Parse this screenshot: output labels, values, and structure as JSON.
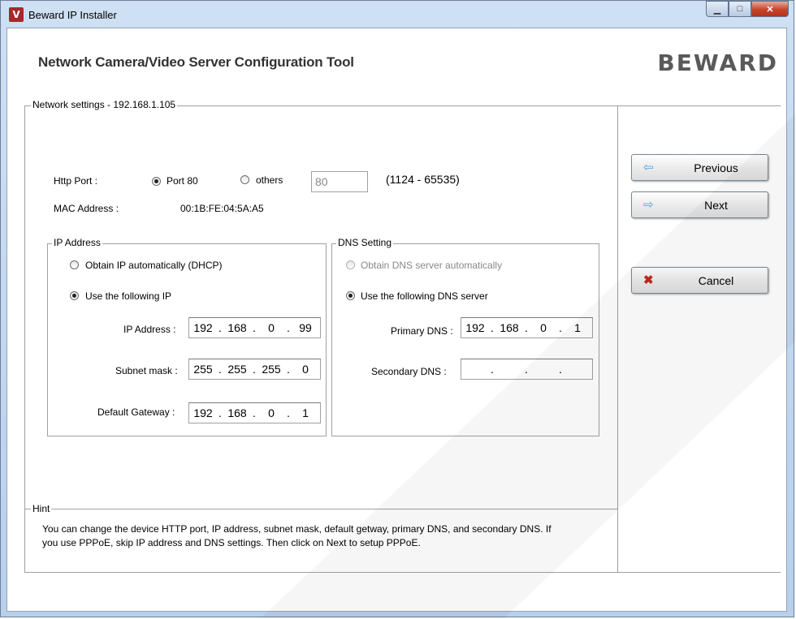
{
  "window": {
    "title": "Beward IP Installer",
    "icon": "beward-app-icon",
    "controls": {
      "minimize": "minimize-icon",
      "maximize": "maximize-icon",
      "close": "close-icon"
    }
  },
  "header": {
    "title": "Network Camera/Video Server Configuration Tool",
    "logo": "BEWARD"
  },
  "network": {
    "legend": "Network settings - 192.168.1.105",
    "http_port_label": "Http Port :",
    "port80_label": "Port 80",
    "others_label": "others",
    "port_value": "80",
    "port_range": "(1124 - 65535)",
    "mac_label": "MAC Address :",
    "mac_value": "00:1B:FE:04:5A:A5",
    "selected_port": "Port 80"
  },
  "ip": {
    "legend": "IP Address",
    "dhcp_label": "Obtain IP automatically (DHCP)",
    "static_label": "Use the following IP",
    "selected": "static",
    "address_label": "IP Address :",
    "address": [
      "192",
      "168",
      "0",
      "99"
    ],
    "subnet_label": "Subnet mask :",
    "subnet": [
      "255",
      "255",
      "255",
      "0"
    ],
    "gateway_label": "Default Gateway :",
    "gateway": [
      "192",
      "168",
      "0",
      "1"
    ]
  },
  "dns": {
    "legend": "DNS Setting",
    "auto_label": "Obtain DNS server automatically",
    "manual_label": "Use the following DNS server",
    "selected": "manual",
    "primary_label": "Primary DNS :",
    "primary": [
      "192",
      "168",
      "0",
      "1"
    ],
    "secondary_label": "Secondary DNS :",
    "secondary": [
      "",
      "",
      "",
      ""
    ]
  },
  "hint": {
    "legend": "Hint",
    "line1": "You can change the device HTTP port, IP address, subnet mask, default getway, primary DNS, and secondary DNS. If",
    "line2": "you use PPPoE, skip IP address and DNS settings. Then click on Next to setup PPPoE."
  },
  "buttons": {
    "previous": "Previous",
    "next": "Next",
    "cancel": "Cancel"
  },
  "colors": {
    "close_button": "#c7432a",
    "logo": "#5a5a5a",
    "arrow_icon": "#4aa3df",
    "cancel_icon": "#c0281e"
  }
}
